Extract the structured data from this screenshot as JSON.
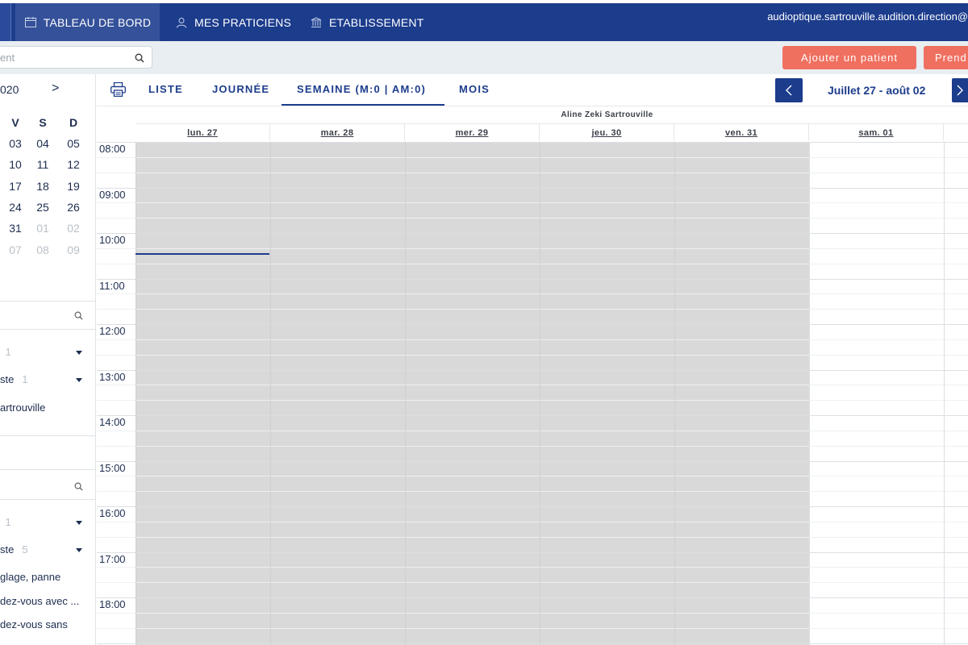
{
  "topnav": {
    "tabs": [
      {
        "label": "TABLEAU DE BORD",
        "icon": "calendar-icon",
        "active": true
      },
      {
        "label": "MES PRATICIENS",
        "icon": "user-icon",
        "active": false
      },
      {
        "label": "ETABLISSEMENT",
        "icon": "bank-icon",
        "active": false
      }
    ],
    "user_email": "audioptique.sartrouville.audition.direction@"
  },
  "actionbar": {
    "search_placeholder": "ent",
    "add_patient_label": "Ajouter un patient",
    "take_appointment_label": "Prend"
  },
  "sidebar": {
    "mini_calendar": {
      "header": "020",
      "next": ">",
      "weekdays": [
        "V",
        "S",
        "D"
      ],
      "weeks": [
        [
          {
            "d": "03"
          },
          {
            "d": "04"
          },
          {
            "d": "05"
          }
        ],
        [
          {
            "d": "10"
          },
          {
            "d": "11"
          },
          {
            "d": "12"
          }
        ],
        [
          {
            "d": "17"
          },
          {
            "d": "18"
          },
          {
            "d": "19"
          }
        ],
        [
          {
            "d": "24"
          },
          {
            "d": "25"
          },
          {
            "d": "26"
          }
        ],
        [
          {
            "d": "31"
          },
          {
            "d": "01",
            "dim": true
          },
          {
            "d": "02",
            "dim": true
          }
        ],
        [
          {
            "d": "07",
            "dim": true
          },
          {
            "d": "08",
            "dim": true
          },
          {
            "d": "09",
            "dim": true
          }
        ]
      ]
    },
    "section1": {
      "filter1_count": "1",
      "filter2_label": "ste",
      "filter2_count": "1",
      "item": "artrouville"
    },
    "section2": {
      "filter1_count": "1",
      "filter2_label": "ste",
      "filter2_count": "5",
      "items": [
        "glage, panne",
        "dez-vous avec ...",
        "dez-vous sans"
      ]
    }
  },
  "calendar": {
    "views": [
      "LISTE",
      "JOURNÉE",
      "SEMAINE (M:0 | AM:0)",
      "MOIS"
    ],
    "active_view": "SEMAINE (M:0 | AM:0)",
    "prev_icon": "chevron-left-icon",
    "next_icon": "chevron-right-icon",
    "range_label": "Juillet 27 - août 02",
    "resource_name": "Aline Zeki Sartrouville",
    "days": [
      "lun. 27",
      "mar. 28",
      "mer. 29",
      "jeu. 30",
      "ven. 31",
      "sam. 01"
    ],
    "hours": [
      "08:00",
      "09:00",
      "10:00",
      "11:00",
      "12:00",
      "13:00",
      "14:00",
      "15:00",
      "16:00",
      "17:00",
      "18:00"
    ],
    "colors": {
      "closed": "#d9d9d9",
      "primary": "#1c3c8c",
      "accent": "#f07060"
    }
  }
}
